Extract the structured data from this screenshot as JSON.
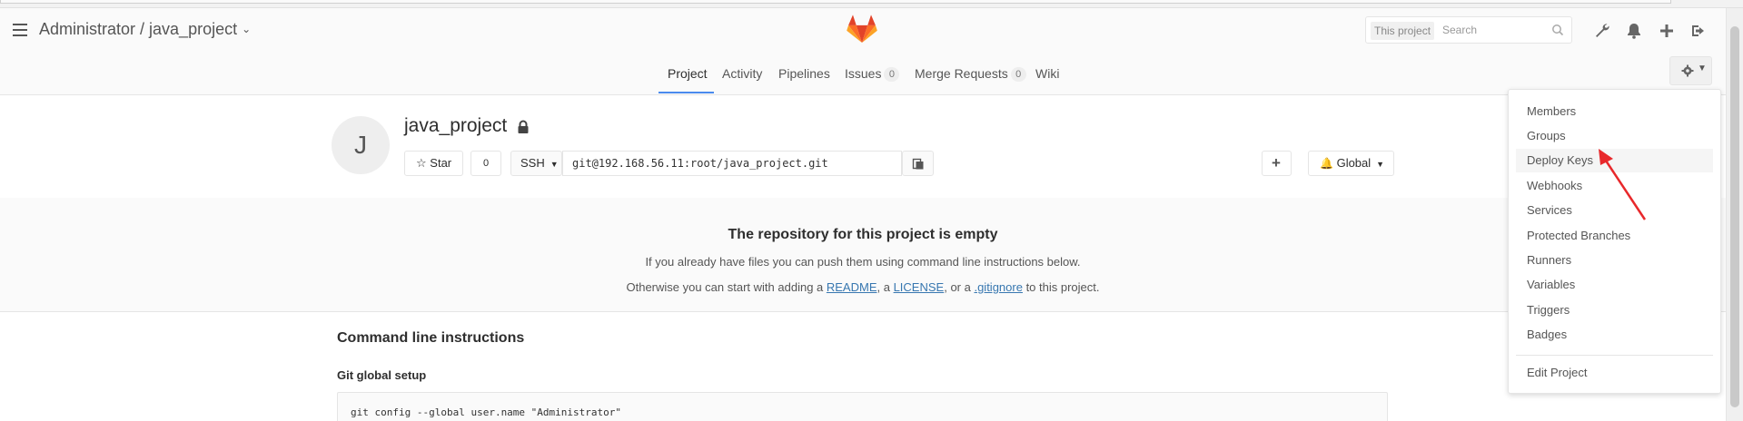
{
  "header": {
    "breadcrumb": "Administrator / java_project",
    "search": {
      "scope_label": "This project",
      "placeholder": "Search"
    }
  },
  "subnav": {
    "items": [
      {
        "label": "Project"
      },
      {
        "label": "Activity"
      },
      {
        "label": "Pipelines"
      },
      {
        "label": "Issues",
        "count": "0"
      },
      {
        "label": "Merge Requests",
        "count": "0"
      },
      {
        "label": "Wiki"
      }
    ]
  },
  "project": {
    "avatar_letter": "J",
    "name": "java_project",
    "star_label": "Star",
    "star_count": "0",
    "protocol": "SSH",
    "clone_url": "git@192.168.56.11:root/java_project.git",
    "notification_level": "Global"
  },
  "empty_state": {
    "title": "The repository for this project is empty",
    "line1": "If you already have files you can push them using command line instructions below.",
    "line2_prefix": "Otherwise you can start with adding a ",
    "readme": "README",
    "sep1": ", a ",
    "license": "LICENSE",
    "sep2": ", or a ",
    "gitignore": ".gitignore",
    "line2_suffix": " to this project."
  },
  "instructions": {
    "title": "Command line instructions",
    "git_setup_title": "Git global setup",
    "code_line1": "git config --global user.name \"Administrator\""
  },
  "settings_menu": {
    "items": [
      {
        "label": "Members"
      },
      {
        "label": "Groups"
      },
      {
        "label": "Deploy Keys"
      },
      {
        "label": "Webhooks"
      },
      {
        "label": "Services"
      },
      {
        "label": "Protected Branches"
      },
      {
        "label": "Runners"
      },
      {
        "label": "Variables"
      },
      {
        "label": "Triggers"
      },
      {
        "label": "Badges"
      }
    ],
    "edit_project": "Edit Project",
    "highlighted_index": 2
  },
  "colors": {
    "link": "#3777b0",
    "active_tab_underline": "#4a8bee",
    "annotation_arrow": "#e8282b",
    "logo_orange": "#e24329",
    "logo_light": "#fca326"
  }
}
